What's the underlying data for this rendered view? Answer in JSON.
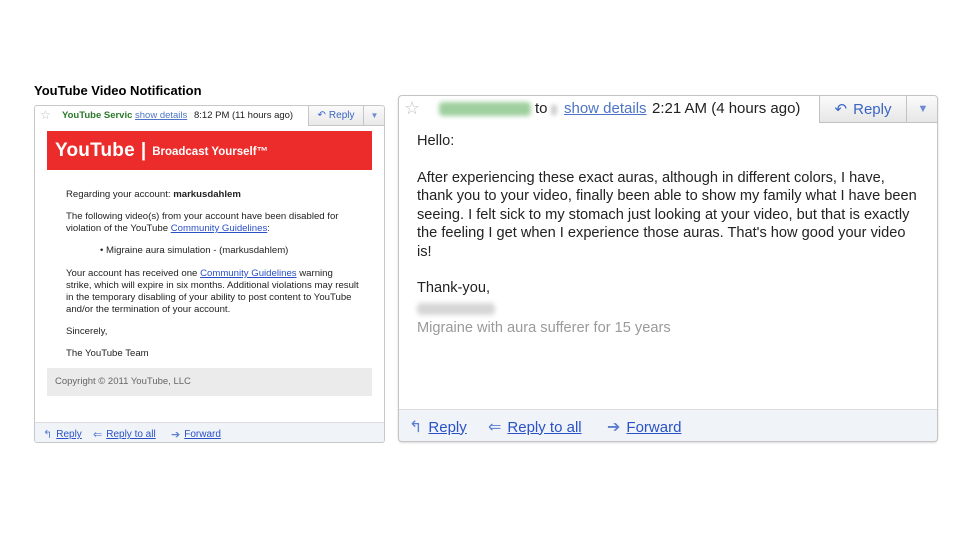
{
  "section_title": "YouTube Video Notification",
  "left_email": {
    "sender": "YouTube Service",
    "show_details": "show details",
    "time": "8:12 PM (11 hours ago)",
    "reply_label": "Reply",
    "banner": {
      "logo": "YouTube",
      "separator": "|",
      "tagline": "Broadcast Yourself™",
      "color": "#ec2c2b"
    },
    "body": {
      "regarding_prefix": "Regarding your account: ",
      "account": "markusdahlem",
      "disabled_text": "The following video(s) from your account have been disabled for violation of the YouTube ",
      "guidelines_link": "Community Guidelines",
      "colon": ":",
      "bullet_item": "Migraine aura simulation - (markusdahlem)",
      "strike_prefix": "Your account has received one ",
      "strike_suffix": " warning strike, which will expire in six months. Additional violations may result in the temporary disabling of your ability to post content to YouTube and/or the termination of your account.",
      "sincerely": "Sincerely,",
      "team": "The YouTube Team"
    },
    "footer": "Copyright © 2011 YouTube, LLC",
    "actions": {
      "reply": "Reply",
      "reply_all": "Reply to all",
      "forward": "Forward"
    }
  },
  "right_email": {
    "to": "to",
    "show_details": "show details",
    "time": "2:21 AM (4 hours ago)",
    "reply_label": "Reply",
    "greeting": "Hello:",
    "paragraph": "After experiencing these exact auras, although in different colors, I have, thank you to your video, finally been able to show my family what I have been seeing.  I felt sick to my stomach just looking at your video, but that is exactly the feeling I get when I experience those auras.  That's how good your video is!",
    "closing": "Thank-you,",
    "signature_line": "Migraine with aura sufferer for 15 years",
    "actions": {
      "reply": "Reply",
      "reply_all": "Reply to all",
      "forward": "Forward"
    }
  },
  "colors": {
    "link": "#2a52c6",
    "youtube_red": "#ec2c2b",
    "sender_green": "#2a7a2a"
  },
  "icons": {
    "star": "star-icon",
    "reply": "reply-arrow-icon",
    "reply_all": "reply-all-icon",
    "forward": "forward-arrow-icon",
    "dropdown": "triangle-down-icon"
  }
}
